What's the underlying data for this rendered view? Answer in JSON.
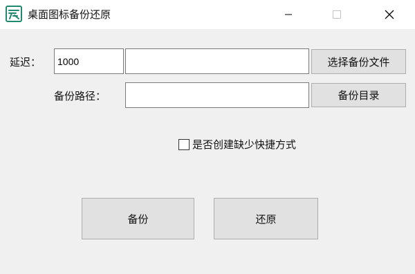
{
  "window": {
    "title": "桌面图标备份还原",
    "icon": "app-logo-icon",
    "controls": [
      "minimize-icon",
      "maximize-icon",
      "close-icon"
    ]
  },
  "form": {
    "delay_label": "延迟：",
    "delay_value": "1000",
    "backup_file_value": "",
    "choose_file_button": "选择备份文件",
    "backup_path_label": "备份路径：",
    "backup_path_value": "",
    "backup_dir_button": "备份目录",
    "create_missing_shortcuts": {
      "label": "是否创建缺少快捷方式",
      "checked": false
    }
  },
  "actions": {
    "backup_button": "备份",
    "restore_button": "还原"
  },
  "colors": {
    "window_bg": "#f0f0f0",
    "titlebar_bg": "#ffffff",
    "button_bg": "#e1e1e1",
    "button_border": "#adadad",
    "input_border": "#7a7a7a",
    "icon_green": "#1f8a70"
  }
}
